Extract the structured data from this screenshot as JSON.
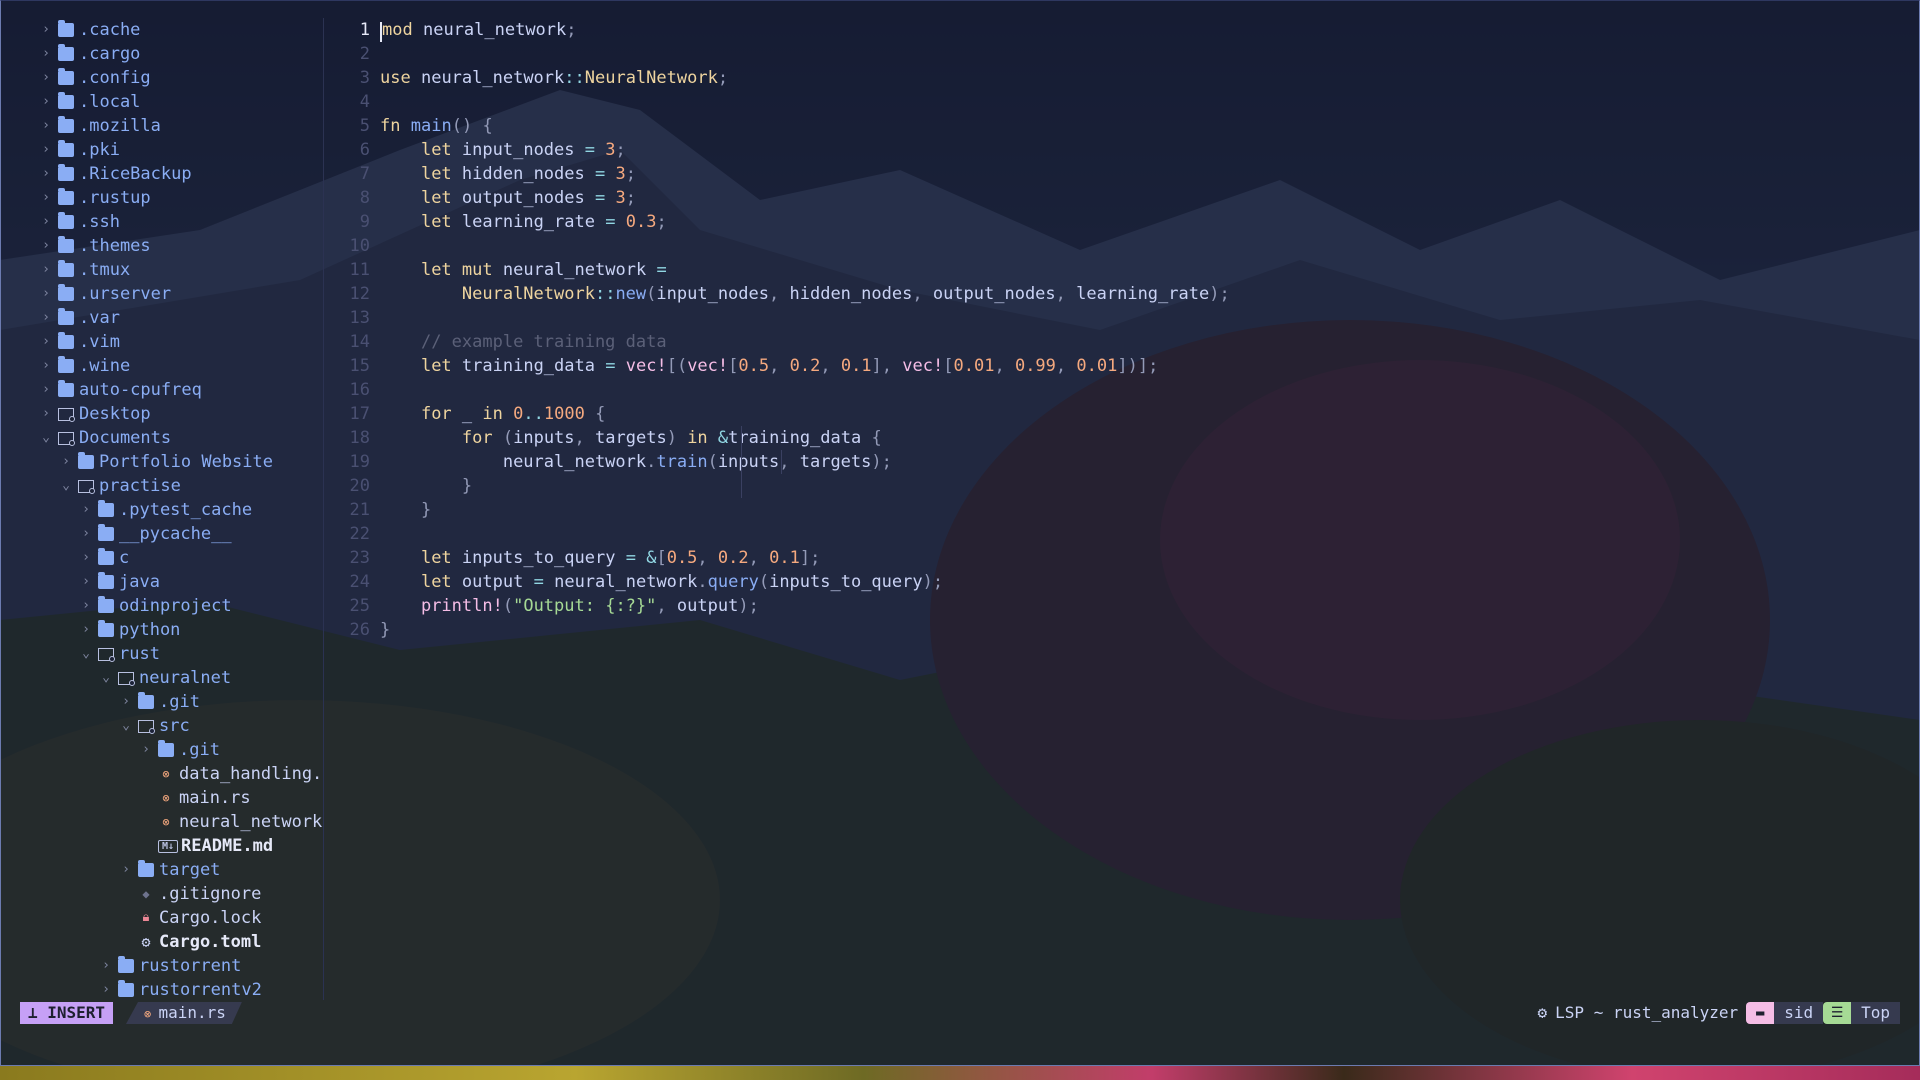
{
  "tree": {
    "items": [
      {
        "name": ".cache",
        "depth": 0,
        "type": "folder"
      },
      {
        "name": ".cargo",
        "depth": 0,
        "type": "folder"
      },
      {
        "name": ".config",
        "depth": 0,
        "type": "folder"
      },
      {
        "name": ".local",
        "depth": 0,
        "type": "folder"
      },
      {
        "name": ".mozilla",
        "depth": 0,
        "type": "folder"
      },
      {
        "name": ".pki",
        "depth": 0,
        "type": "folder"
      },
      {
        "name": ".RiceBackup",
        "depth": 0,
        "type": "folder"
      },
      {
        "name": ".rustup",
        "depth": 0,
        "type": "folder"
      },
      {
        "name": ".ssh",
        "depth": 0,
        "type": "folder"
      },
      {
        "name": ".themes",
        "depth": 0,
        "type": "folder"
      },
      {
        "name": ".tmux",
        "depth": 0,
        "type": "folder"
      },
      {
        "name": ".urserver",
        "depth": 0,
        "type": "folder"
      },
      {
        "name": ".var",
        "depth": 0,
        "type": "folder"
      },
      {
        "name": ".vim",
        "depth": 0,
        "type": "folder"
      },
      {
        "name": ".wine",
        "depth": 0,
        "type": "folder"
      },
      {
        "name": "auto-cpufreq",
        "depth": 0,
        "type": "folder"
      },
      {
        "name": "Desktop",
        "depth": 0,
        "type": "folder-outline"
      },
      {
        "name": "Documents",
        "depth": 0,
        "type": "folder-open"
      },
      {
        "name": "Portfolio Website",
        "depth": 1,
        "type": "folder"
      },
      {
        "name": "practise",
        "depth": 1,
        "type": "folder-open"
      },
      {
        "name": ".pytest_cache",
        "depth": 2,
        "type": "folder"
      },
      {
        "name": "__pycache__",
        "depth": 2,
        "type": "folder"
      },
      {
        "name": "c",
        "depth": 2,
        "type": "folder"
      },
      {
        "name": "java",
        "depth": 2,
        "type": "folder"
      },
      {
        "name": "odinproject",
        "depth": 2,
        "type": "folder"
      },
      {
        "name": "python",
        "depth": 2,
        "type": "folder"
      },
      {
        "name": "rust",
        "depth": 2,
        "type": "folder-open"
      },
      {
        "name": "neuralnet",
        "depth": 3,
        "type": "folder-open"
      },
      {
        "name": ".git",
        "depth": 4,
        "type": "folder"
      },
      {
        "name": "src",
        "depth": 4,
        "type": "folder-open"
      },
      {
        "name": ".git",
        "depth": 5,
        "type": "folder"
      },
      {
        "name": "data_handling.",
        "depth": 5,
        "type": "rs"
      },
      {
        "name": "main.rs",
        "depth": 5,
        "type": "rs"
      },
      {
        "name": "neural_network",
        "depth": 5,
        "type": "rs"
      },
      {
        "name": "README.md",
        "depth": 5,
        "type": "md"
      },
      {
        "name": "target",
        "depth": 4,
        "type": "folder"
      },
      {
        "name": ".gitignore",
        "depth": 4,
        "type": "git"
      },
      {
        "name": "Cargo.lock",
        "depth": 4,
        "type": "lock"
      },
      {
        "name": "Cargo.toml",
        "depth": 4,
        "type": "toml"
      },
      {
        "name": "rustorrent",
        "depth": 3,
        "type": "folder"
      },
      {
        "name": "rustorrentv2",
        "depth": 3,
        "type": "folder"
      }
    ]
  },
  "editor": {
    "current_line": 1,
    "lines": [
      "mod neural_network;",
      "",
      "use neural_network::NeuralNetwork;",
      "",
      "fn main() {",
      "    let input_nodes = 3;",
      "    let hidden_nodes = 3;",
      "    let output_nodes = 3;",
      "    let learning_rate = 0.3;",
      "",
      "    let mut neural_network =",
      "        NeuralNetwork::new(input_nodes, hidden_nodes, output_nodes, learning_rate);",
      "",
      "    // example training data",
      "    let training_data = vec![(vec![0.5, 0.2, 0.1], vec![0.01, 0.99, 0.01])];",
      "",
      "    for _ in 0..1000 {",
      "        for (inputs, targets) in &training_data {",
      "            neural_network.train(inputs, targets);",
      "        }",
      "    }",
      "",
      "    let inputs_to_query = &[0.5, 0.2, 0.1];",
      "    let output = neural_network.query(inputs_to_query);",
      "    println!(\"Output: {:?}\", output);",
      "}"
    ]
  },
  "statusline": {
    "mode": "INSERT",
    "file": "main.rs",
    "lsp": "LSP ~ rust_analyzer",
    "user": "sid",
    "position": "Top"
  },
  "colors": {
    "mode_bg": "#c6a0f6",
    "folder": "#8aadf4",
    "user_pill": "#f5bde6",
    "pos_pill": "#a6da95"
  }
}
